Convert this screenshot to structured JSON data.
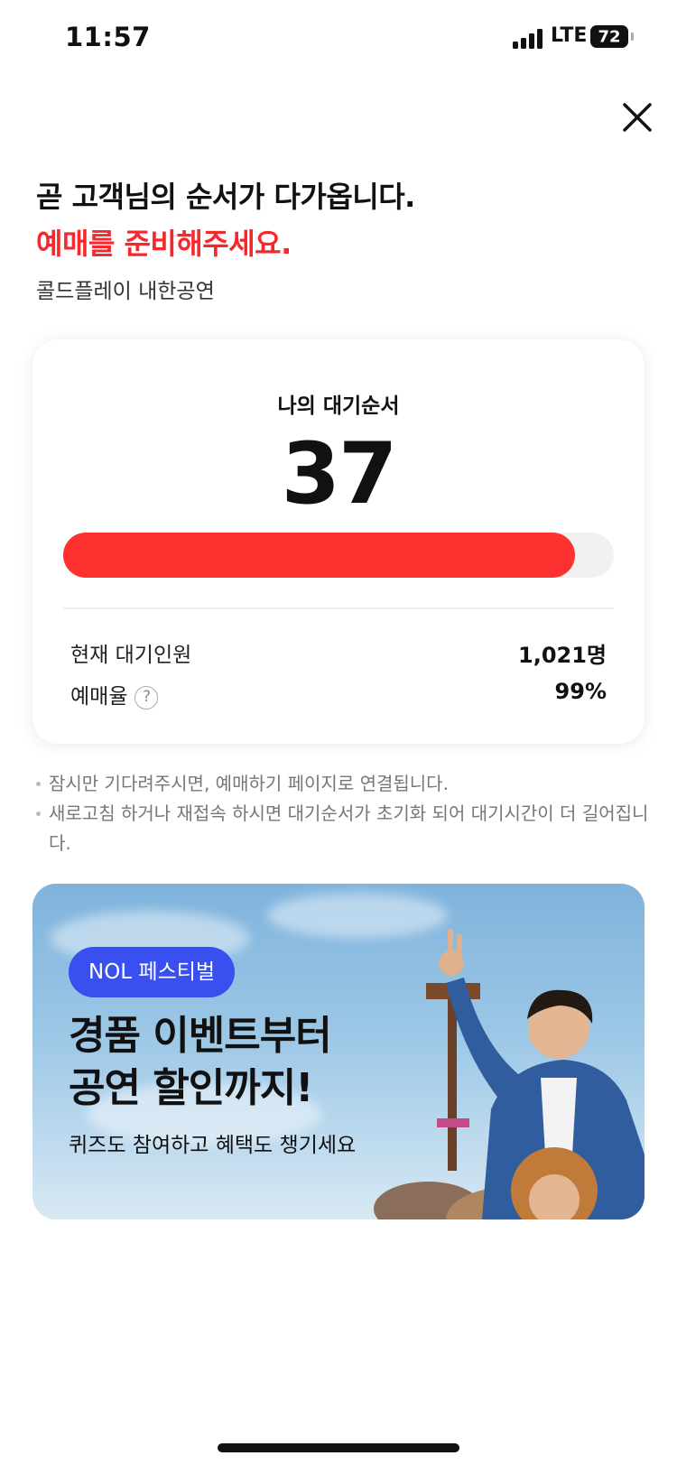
{
  "status_bar": {
    "time": "11:57",
    "network": "LTE",
    "battery": "72"
  },
  "header": {
    "title": "곧 고객님의 순서가 다가옵니다.",
    "subtitle": "예매를 준비해주세요.",
    "event_name": "콜드플레이 내한공연"
  },
  "queue": {
    "label": "나의 대기순서",
    "position": "37",
    "progress_fraction": 0.93,
    "current_waiting_label": "현재 대기인원",
    "current_waiting_value": "1,021명",
    "booking_rate_label": "예매율",
    "booking_rate_help": "?",
    "booking_rate_value": "99%"
  },
  "notes": [
    "잠시만 기다려주시면, 예매하기 페이지로 연결됩니다.",
    "새로고침 하거나 재접속 하시면 대기순서가 초기화 되어 대기시간이 더 길어집니다."
  ],
  "banner": {
    "tag": "NOL 페스티벌",
    "title_line1": "경품 이벤트부터",
    "title_line2": "공연 할인까지!",
    "description": "퀴즈도 참여하고 혜택도 챙기세요"
  },
  "colors": {
    "accent_red": "#f5282c",
    "progress_red": "#fe3131",
    "tag_blue": "#3a4ff0"
  }
}
